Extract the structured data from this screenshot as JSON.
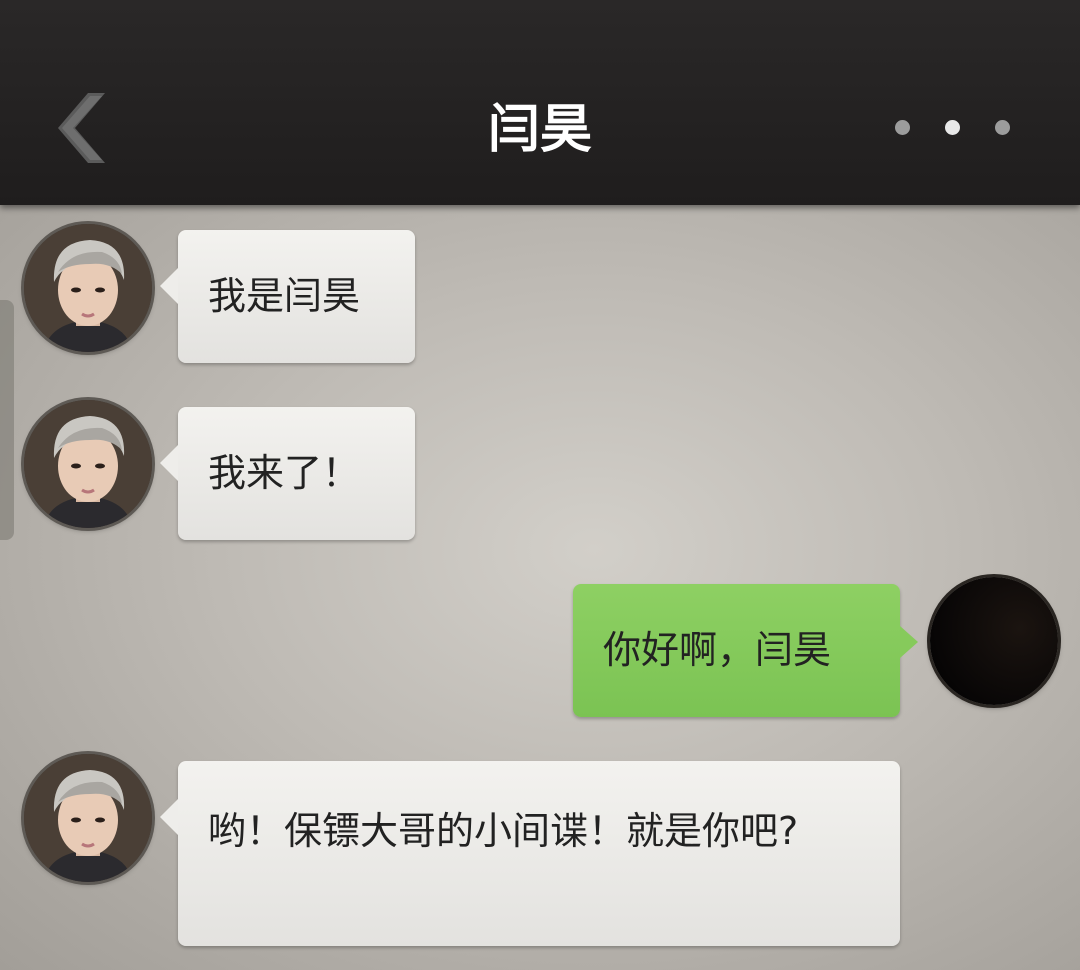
{
  "header": {
    "title": "闫昊",
    "back_icon": "chevron-left-icon",
    "more_icon": "more-dots-icon"
  },
  "colors": {
    "header_bg": "#201e1e",
    "incoming_bubble": "#eeedea",
    "outgoing_bubble": "#82c85a",
    "chat_bg": "#bebab4"
  },
  "messages": [
    {
      "side": "left",
      "text": "我是闫昊"
    },
    {
      "side": "left",
      "text": "我来了！"
    },
    {
      "side": "right",
      "text": "你好啊，闫昊"
    },
    {
      "side": "left",
      "text": "哟！保镖大哥的小间谍！就是你吧?"
    }
  ]
}
